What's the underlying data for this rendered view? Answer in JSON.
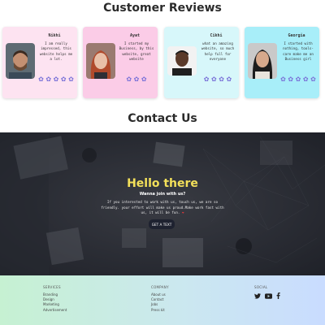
{
  "reviews": {
    "title": "Customer Reviews",
    "cards": [
      {
        "name": "Nikhi",
        "text": "I am really impressed, this website helps me a lot.",
        "stars": "✿ ✿ ✿ ✿ ✿",
        "bg": "#fde3f1"
      },
      {
        "name": "Ayat",
        "text": "I started my Business, by this website, great website",
        "stars": "✿ ✿ ✿",
        "bg": "#fbcce7"
      },
      {
        "name": "Cikhi",
        "text": "what an amazing website, so much help full for everyone",
        "stars": "✿ ✿ ✿ ✿",
        "bg": "#d7f7fa"
      },
      {
        "name": "Georgia",
        "text": "I started with nothing, tools-care make me an Business girl",
        "stars": "✿ ✿ ✿ ✿ ✿",
        "bg": "#a8eef9"
      }
    ]
  },
  "contact": {
    "title": "Contact Us",
    "hero_title": "Hello there",
    "hero_sub": "Wanna join with us?",
    "hero_body": "If you interested to work with us, touch us, we are so friendly. your effort will make us proud.Make work fast with us, it will be fun.",
    "heart": "❤",
    "button": "GET A TEXT"
  },
  "footer": {
    "services": {
      "heading": "SERVICES",
      "links": [
        "Branding",
        "Design",
        "Marketing",
        "Advertisement"
      ]
    },
    "company": {
      "heading": "COMPANY",
      "links": [
        "About us",
        "Contact",
        "Jobs",
        "Press kit"
      ]
    },
    "social": {
      "heading": "SOCIAL",
      "icons": [
        "twitter-icon",
        "youtube-icon",
        "facebook-icon"
      ]
    }
  }
}
